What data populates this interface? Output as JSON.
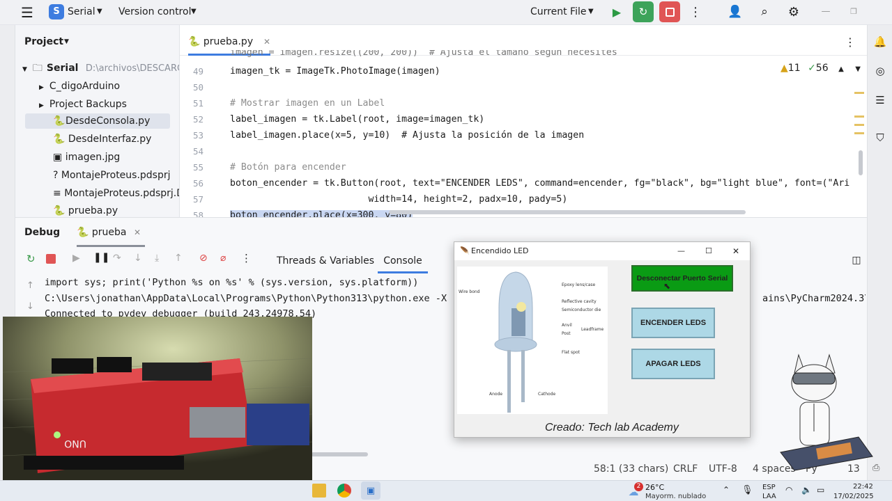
{
  "titlebar": {
    "project_letter": "S",
    "project_name": "Serial",
    "vcs": "Version control",
    "run_config": "Current File"
  },
  "project_panel": {
    "title": "Project",
    "items": [
      {
        "label": "Serial",
        "path": "D:\\archivos\\DESCARG"
      },
      {
        "label": "C_digoArduino"
      },
      {
        "label": "Project Backups"
      },
      {
        "label": "DesdeConsola.py"
      },
      {
        "label": "DesdeInterfaz.py"
      },
      {
        "label": "imagen.jpg"
      },
      {
        "label": "MontajeProteus.pdsprj"
      },
      {
        "label": "MontajeProteus.pdsprj.D"
      },
      {
        "label": "prueba.py"
      }
    ]
  },
  "editor": {
    "tab": "prueba.py",
    "warnings": "11",
    "checks": "56",
    "line_numbers": [
      "49",
      "50",
      "51",
      "52",
      "53",
      "54",
      "55",
      "56",
      "57",
      "58"
    ],
    "partial_top": "imagen = imagen.resize((200, 200))  # Ajusta el tamaño según necesites",
    "lines": [
      "imagen_tk = ImageTk.PhotoImage(imagen)",
      "",
      "# Mostrar imagen en un Label",
      "label_imagen = tk.Label(root, image=imagen_tk)",
      "label_imagen.place(x=5, y=10)  # Ajusta la posición de la imagen",
      "",
      "# Botón para encender",
      "boton_encender = tk.Button(root, text=\"ENCENDER LEDS\", command=encender, fg=\"black\", bg=\"light blue\", font=(\"Ari",
      "                         width=14, height=2, padx=10, pady=5)",
      "boton_encender.place(x=300, y=80)"
    ]
  },
  "debug": {
    "title": "Debug",
    "session": "prueba",
    "tab_threads": "Threads & Variables",
    "tab_console": "Console",
    "console": [
      "import sys; print('Python %s on %s' % (sys.version, sys.platform))",
      "C:\\Users\\jonathan\\AppData\\Local\\Programs\\Python\\Python313\\python.exe -X",
      "Connected to pydev debugger (build 243.24978.54)"
    ],
    "console_right": "ains\\PyCharm2024.3\\c"
  },
  "tk_window": {
    "title": "Encendido LED",
    "btn_disconnect": "Desconectar Puerto Serial",
    "btn_on": "ENCENDER LEDS",
    "btn_off": "APAGAR LEDS",
    "footer": "Creado: Tech lab Academy",
    "diagram": {
      "labels": [
        "Epoxy lens/case",
        "Wire bond",
        "Reflective cavity",
        "Semiconductor die",
        "Anvil",
        "Post",
        "Leadframe",
        "Flat spot",
        "Anode",
        "Cathode"
      ]
    }
  },
  "status": {
    "position": "58:1 (33 chars)",
    "line_sep": "CRLF",
    "encoding": "UTF-8",
    "indent": "4 spaces",
    "interpreter": "Py",
    "version_tail": "13"
  },
  "taskbar": {
    "badge": "2",
    "temp": "26°C",
    "weather": "Mayorm. nublado",
    "lang1": "ESP",
    "lang2": "LAA",
    "time": "22:42",
    "date": "17/02/2025"
  },
  "photo": {
    "board_text": "UNO"
  }
}
